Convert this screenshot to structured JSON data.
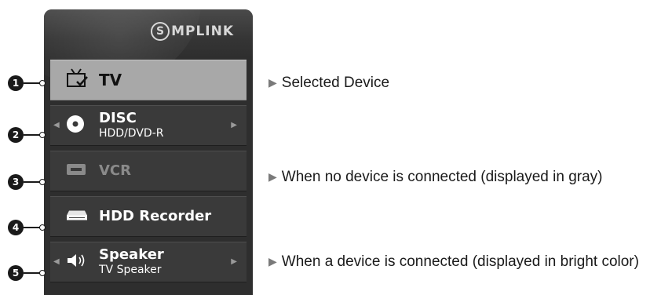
{
  "simplink": {
    "logo_letter": "S",
    "logo_text": "MPLINK"
  },
  "menu": {
    "items": [
      {
        "label": "TV",
        "icon": "tv-check-icon",
        "state": "selected"
      },
      {
        "label": "DISC",
        "sub": "HDD/DVD-R",
        "icon": "disc-icon",
        "state": "connected",
        "arrows": true
      },
      {
        "label": "VCR",
        "icon": "vcr-icon",
        "state": "not-connected"
      },
      {
        "label": "HDD Recorder",
        "icon": "hdd-recorder-icon",
        "state": "connected"
      },
      {
        "label": "Speaker",
        "sub": "TV Speaker",
        "icon": "speaker-icon",
        "state": "connected",
        "arrows": true
      }
    ]
  },
  "callouts": [
    "1",
    "2",
    "3",
    "4",
    "5"
  ],
  "descriptions": {
    "selected": "Selected Device",
    "no_device": "When no device is connected (displayed in gray)",
    "connected": "When a device is connected (displayed in bright color)"
  },
  "colors": {
    "panel": "#2e2e2e",
    "selected_row": "#a8a8a8",
    "gray_text": "#8a8a8a"
  }
}
